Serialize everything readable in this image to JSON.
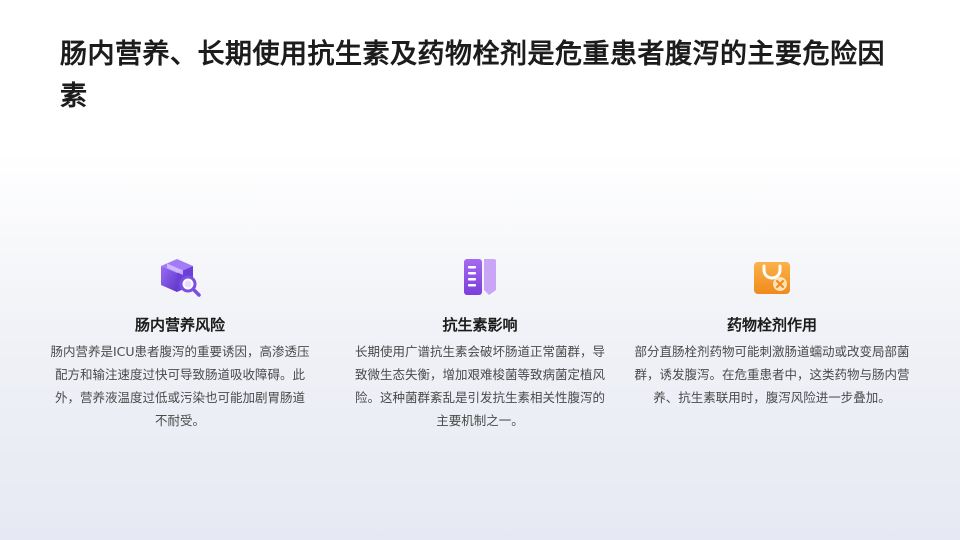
{
  "slide": {
    "title": "肠内营养、长期使用抗生素及药物栓剂是危重患者腹泻的主要危险因素"
  },
  "cards": [
    {
      "icon": "box-search-icon",
      "title": "肠内营养风险",
      "text": "肠内营养是ICU患者腹泻的重要诱因，高渗透压配方和输注速度过快可导致肠道吸收障碍。此外，营养液温度过低或污染也可能加剧胃肠道不耐受。",
      "accent": "#7b4fe0"
    },
    {
      "icon": "book-bookmark-icon",
      "title": "抗生素影响",
      "text": "长期使用广谱抗生素会破坏肠道正常菌群，导致微生态失衡，增加艰难梭菌等致病菌定植风险。这种菌群紊乱是引发抗生素相关性腹泻的主要机制之一。",
      "accent": "#8a4fe0"
    },
    {
      "icon": "shopping-bag-icon",
      "title": "药物栓剂作用",
      "text": "部分直肠栓剂药物可能刺激肠道蠕动或改变局部菌群，诱发腹泻。在危重患者中，这类药物与肠内营养、抗生素联用时，腹泻风险进一步叠加。",
      "accent": "#f5a02e"
    }
  ]
}
